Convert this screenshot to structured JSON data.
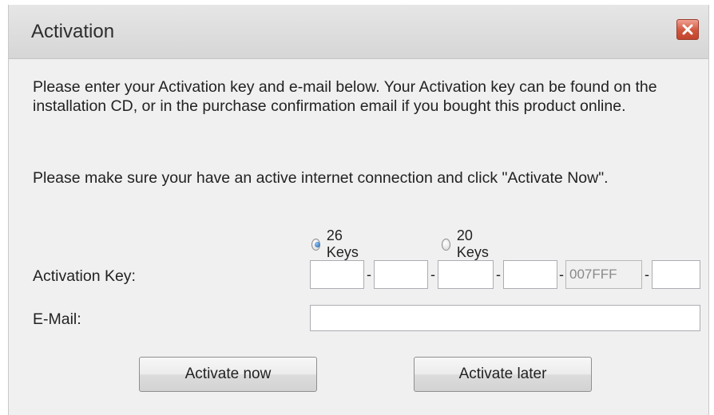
{
  "window": {
    "title": "Activation",
    "close_icon": "close-icon"
  },
  "instructions": {
    "paragraph1": "Please enter your Activation key and e-mail below. Your Activation key can be found on the installation CD, or in the purchase confirmation email if you bought this product online.",
    "paragraph2": "Please make sure your have an active internet connection and click \"Activate Now\"."
  },
  "key_type": {
    "options": [
      {
        "label": "26 Keys",
        "selected": true
      },
      {
        "label": "20 Keys",
        "selected": false
      }
    ]
  },
  "form": {
    "activation_key_label": "Activation Key:",
    "key_segments": [
      "",
      "",
      "",
      "",
      "007FFF",
      ""
    ],
    "separator": "-",
    "email_label": "E-Mail:",
    "email_value": ""
  },
  "buttons": {
    "activate_now": "Activate now",
    "activate_later": "Activate later"
  },
  "colors": {
    "close_button": "#c2452e",
    "dialog_background": "#f0f0f0"
  }
}
